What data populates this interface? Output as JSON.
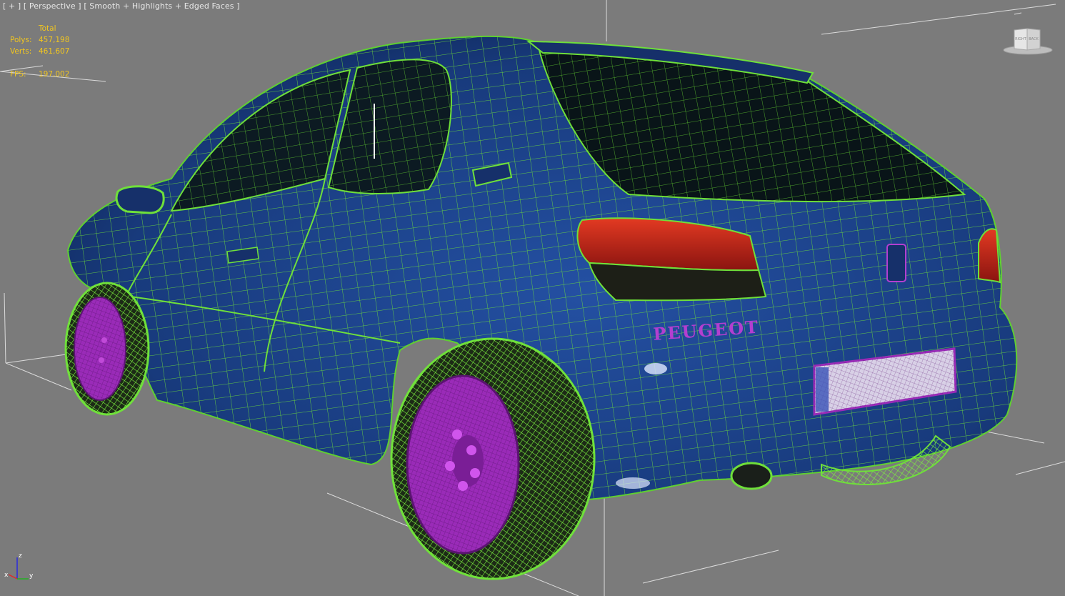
{
  "viewport": {
    "menu_plus": "[ + ]",
    "view_name": "[ Perspective ]",
    "shading_mode": "[ Smooth + Highlights + Edged Faces ]"
  },
  "stats": {
    "header": "Total",
    "polys_label": "Polys:",
    "polys_value": "457,198",
    "verts_label": "Verts:",
    "verts_value": "461,607",
    "fps_label": "FPS:",
    "fps_value": "197,002"
  },
  "viewcube": {
    "left_face": "RIGHT",
    "right_face": "BACK"
  },
  "axes": {
    "z": "z",
    "x": "x",
    "y": "y"
  },
  "model": {
    "badge_text": "PEUGEOT",
    "body_color": "#1a3a7a",
    "wire_color": "#6fe03a",
    "rim_color": "#9a2bb8",
    "light_color": "#c8231a"
  },
  "colors": {
    "background": "#7b7b7b",
    "stats_text": "#f2c61f"
  }
}
